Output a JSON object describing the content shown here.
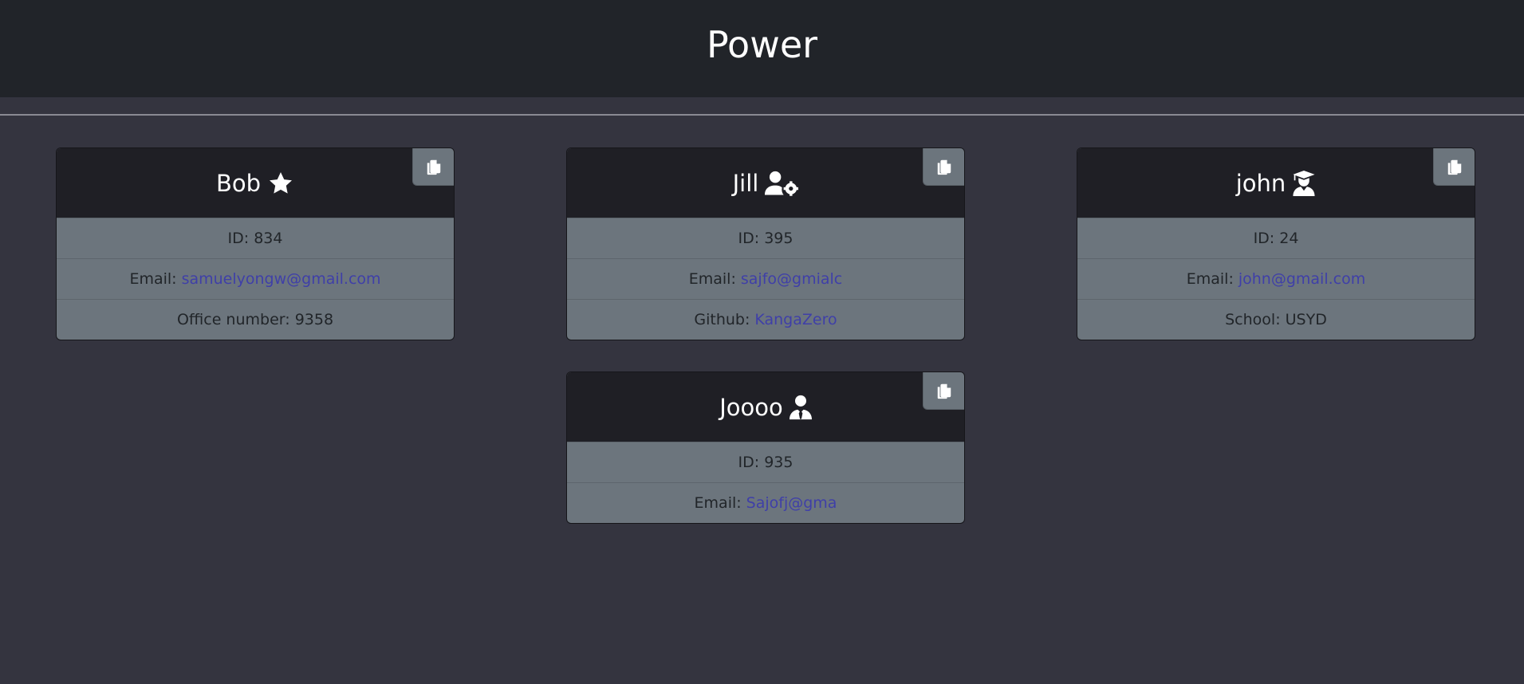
{
  "header": {
    "title": "Power"
  },
  "cards": [
    {
      "name": "Bob",
      "role_icon": "star-icon",
      "id_label": "ID: 834",
      "email_label": "Email:",
      "email": "samuelyongw@gmail.com",
      "extra_label": "Office number: 9358"
    },
    {
      "name": "Jill",
      "role_icon": "user-gear-icon",
      "id_label": "ID: 395",
      "email_label": "Email:",
      "email": "sajfo@gmialc",
      "extra_label": "Github:",
      "extra_link": "KangaZero"
    },
    {
      "name": "john",
      "role_icon": "user-graduate-icon",
      "id_label": "ID: 24",
      "email_label": "Email:",
      "email": "john@gmail.com",
      "extra_label": "School: USYD"
    },
    {
      "name": "Joooo",
      "role_icon": "user-tie-icon",
      "id_label": "ID: 935",
      "email_label": "Email:",
      "email": "Sajofj@gma"
    }
  ],
  "colors": {
    "page_bg": "#34343f",
    "header_bg": "#212429",
    "card_head_bg": "#1f1f25",
    "card_body_bg": "#6c757d",
    "link": "#3f3fa8"
  }
}
